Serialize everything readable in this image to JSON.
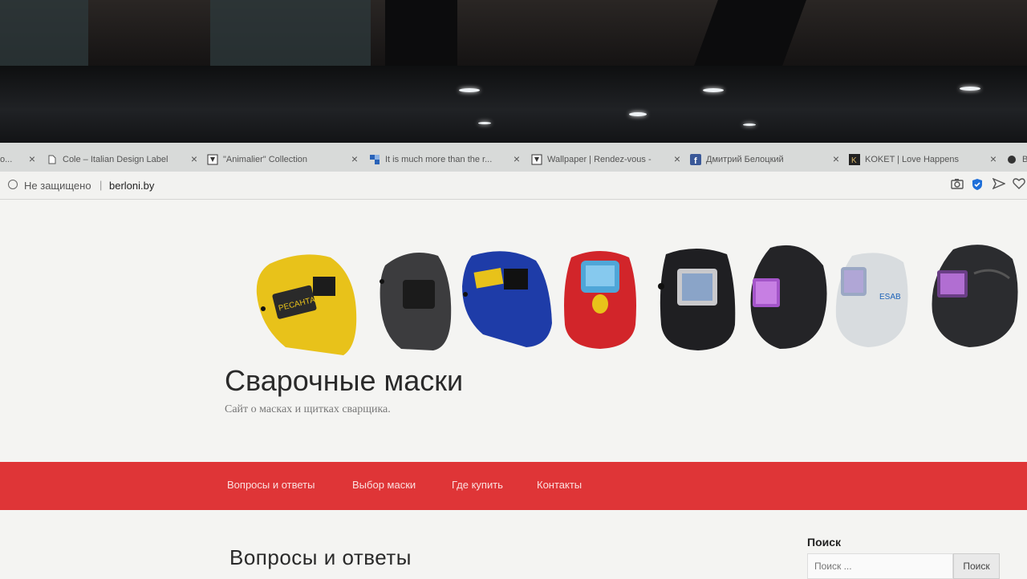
{
  "browser": {
    "tabs": [
      {
        "label": "o...",
        "icon": "page-icon"
      },
      {
        "label": "Cole – Italian Design Label",
        "icon": "page-icon"
      },
      {
        "label": "\"Animalier\" Collection",
        "icon": "site-logo-icon"
      },
      {
        "label": "It is much more than the r...",
        "icon": "tiles-icon"
      },
      {
        "label": "Wallpaper | Rendez-vous -",
        "icon": "site-logo-icon"
      },
      {
        "label": "Дмитрий Белоцкий",
        "icon": "facebook-icon"
      },
      {
        "label": "KOKET | Love Happens",
        "icon": "koket-icon"
      },
      {
        "label": "B",
        "icon": "chat-icon"
      }
    ],
    "address": {
      "security": "Не защищено",
      "separator": "|",
      "url": "berloni.by"
    },
    "toolbar_icons": [
      "camera-icon",
      "shield-check-icon",
      "send-icon",
      "heart-icon"
    ]
  },
  "site": {
    "title": "Сварочные маски",
    "tagline": "Сайт о масках и щитках сварщика.",
    "nav": [
      "Вопросы и ответы",
      "Выбор маски",
      "Где купить",
      "Контакты"
    ],
    "nav_color": "#df3537",
    "helmets": [
      "yellow",
      "black",
      "blue",
      "red",
      "black-large-lens",
      "black-purple-lens",
      "silver",
      "black-wide"
    ]
  },
  "content": {
    "heading": "Вопросы и ответы"
  },
  "sidebar": {
    "search_title": "Поиск",
    "search_placeholder": "Поиск ...",
    "search_button": "Поиск"
  }
}
